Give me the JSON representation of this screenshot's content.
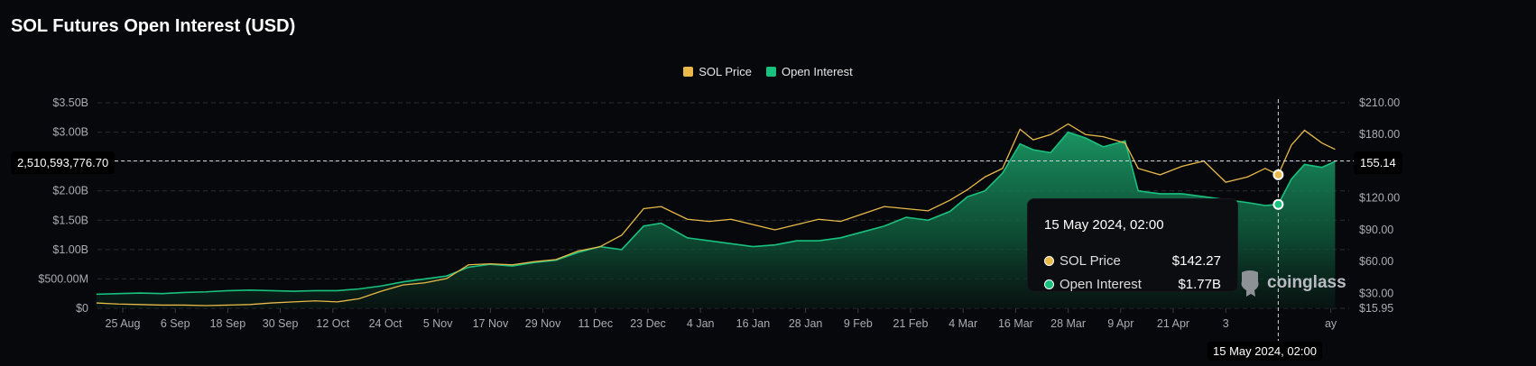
{
  "title": "SOL Futures Open Interest (USD)",
  "logo_text": "coinglass",
  "colors": {
    "price": "#e9b949",
    "open_interest": "#19c17f",
    "background": "#06080c"
  },
  "chart_data": {
    "type": "line",
    "title": "SOL Futures Open Interest (USD)",
    "legend": [
      {
        "name": "SOL Price",
        "color": "#e9b949"
      },
      {
        "name": "Open Interest",
        "color": "#19c17f"
      }
    ],
    "legend_position": "top-center",
    "grid": true,
    "x_tick_labels": [
      "25 Aug",
      "6 Sep",
      "18 Sep",
      "30 Sep",
      "12 Oct",
      "24 Oct",
      "5 Nov",
      "17 Nov",
      "29 Nov",
      "11 Dec",
      "23 Dec",
      "4 Jan",
      "16 Jan",
      "28 Jan",
      "9 Feb",
      "21 Feb",
      "4 Mar",
      "16 Mar",
      "28 Mar",
      "9 Apr",
      "21 Apr",
      "3",
      "ay"
    ],
    "x_tick_dates": [
      "2023-08-25",
      "2023-09-06",
      "2023-09-18",
      "2023-09-30",
      "2023-10-12",
      "2023-10-24",
      "2023-11-05",
      "2023-11-17",
      "2023-11-29",
      "2023-12-11",
      "2023-12-23",
      "2024-01-04",
      "2024-01-16",
      "2024-01-28",
      "2024-02-09",
      "2024-02-21",
      "2024-03-04",
      "2024-03-16",
      "2024-03-28",
      "2024-04-09",
      "2024-04-21",
      "2024-05-03",
      "2024-05-27"
    ],
    "y_left": {
      "ticks": [
        0,
        0.5,
        1,
        1.5,
        2,
        2.5,
        3,
        3.5
      ],
      "tick_labels": [
        "$0",
        "$500.00M",
        "$1.00B",
        "$1.50B",
        "$2.00B",
        "",
        "$3.00B",
        "$3.50B"
      ],
      "range": [
        0,
        3.5
      ],
      "unit": "USD billions"
    },
    "y_right": {
      "ticks": [
        15.95,
        30,
        60,
        90,
        120,
        150,
        180,
        210
      ],
      "tick_labels": [
        "$15.95",
        "$30.00",
        "$60.00",
        "$90.00",
        "$120.00",
        "",
        "$180.00",
        "$210.00"
      ],
      "range": [
        15.95,
        210
      ]
    },
    "crosshair": {
      "date_label": "15 May 2024, 02:00",
      "date": "2024-05-15",
      "left_value_label": "2,510,593,776.70",
      "right_value_label": "155.14",
      "left_value": 2.5106,
      "right_value": 155.14
    },
    "tooltip": {
      "date": "15 May 2024, 02:00",
      "rows": [
        {
          "label": "SOL Price",
          "value": "$142.27"
        },
        {
          "label": "Open Interest",
          "value": "$1.77B"
        }
      ]
    },
    "dates": [
      "2023-08-19",
      "2023-08-24",
      "2023-08-29",
      "2023-09-03",
      "2023-09-08",
      "2023-09-13",
      "2023-09-18",
      "2023-09-23",
      "2023-09-28",
      "2023-10-03",
      "2023-10-08",
      "2023-10-13",
      "2023-10-18",
      "2023-10-23",
      "2023-10-28",
      "2023-11-02",
      "2023-11-07",
      "2023-11-12",
      "2023-11-17",
      "2023-11-22",
      "2023-11-27",
      "2023-12-02",
      "2023-12-07",
      "2023-12-12",
      "2023-12-17",
      "2023-12-22",
      "2023-12-26",
      "2024-01-01",
      "2024-01-06",
      "2024-01-11",
      "2024-01-16",
      "2024-01-21",
      "2024-01-26",
      "2024-01-31",
      "2024-02-05",
      "2024-02-10",
      "2024-02-15",
      "2024-02-20",
      "2024-02-25",
      "2024-03-01",
      "2024-03-05",
      "2024-03-09",
      "2024-03-13",
      "2024-03-17",
      "2024-03-20",
      "2024-03-24",
      "2024-03-28",
      "2024-04-01",
      "2024-04-05",
      "2024-04-10",
      "2024-04-13",
      "2024-04-18",
      "2024-04-23",
      "2024-04-28",
      "2024-05-03",
      "2024-05-08",
      "2024-05-12",
      "2024-05-15",
      "2024-05-18",
      "2024-05-21",
      "2024-05-25",
      "2024-05-28"
    ],
    "series": [
      {
        "name": "SOL Price",
        "axis": "right",
        "values": [
          21,
          20,
          19.5,
          19,
          19,
          18.5,
          19,
          19.5,
          21,
          22,
          23,
          22,
          25,
          32,
          38,
          40,
          44,
          57,
          58,
          57,
          60,
          62,
          70,
          74,
          85,
          110,
          112,
          100,
          98,
          100,
          95,
          90,
          95,
          100,
          98,
          105,
          112,
          110,
          108,
          118,
          128,
          140,
          148,
          185,
          175,
          180,
          190,
          180,
          178,
          172,
          148,
          142,
          150,
          155,
          135,
          140,
          148,
          142,
          170,
          184,
          172,
          166
        ]
      },
      {
        "name": "Open Interest",
        "axis": "left",
        "values": [
          0.24,
          0.25,
          0.26,
          0.25,
          0.27,
          0.28,
          0.3,
          0.31,
          0.3,
          0.29,
          0.3,
          0.3,
          0.33,
          0.38,
          0.45,
          0.5,
          0.55,
          0.7,
          0.75,
          0.72,
          0.78,
          0.82,
          0.95,
          1.05,
          1.0,
          1.4,
          1.45,
          1.2,
          1.15,
          1.1,
          1.05,
          1.08,
          1.15,
          1.15,
          1.2,
          1.3,
          1.4,
          1.55,
          1.5,
          1.65,
          1.9,
          2.0,
          2.3,
          2.8,
          2.7,
          2.65,
          3.0,
          2.9,
          2.75,
          2.85,
          2.0,
          1.95,
          1.95,
          1.9,
          1.85,
          1.8,
          1.75,
          1.77,
          2.2,
          2.45,
          2.4,
          2.5
        ]
      }
    ]
  }
}
